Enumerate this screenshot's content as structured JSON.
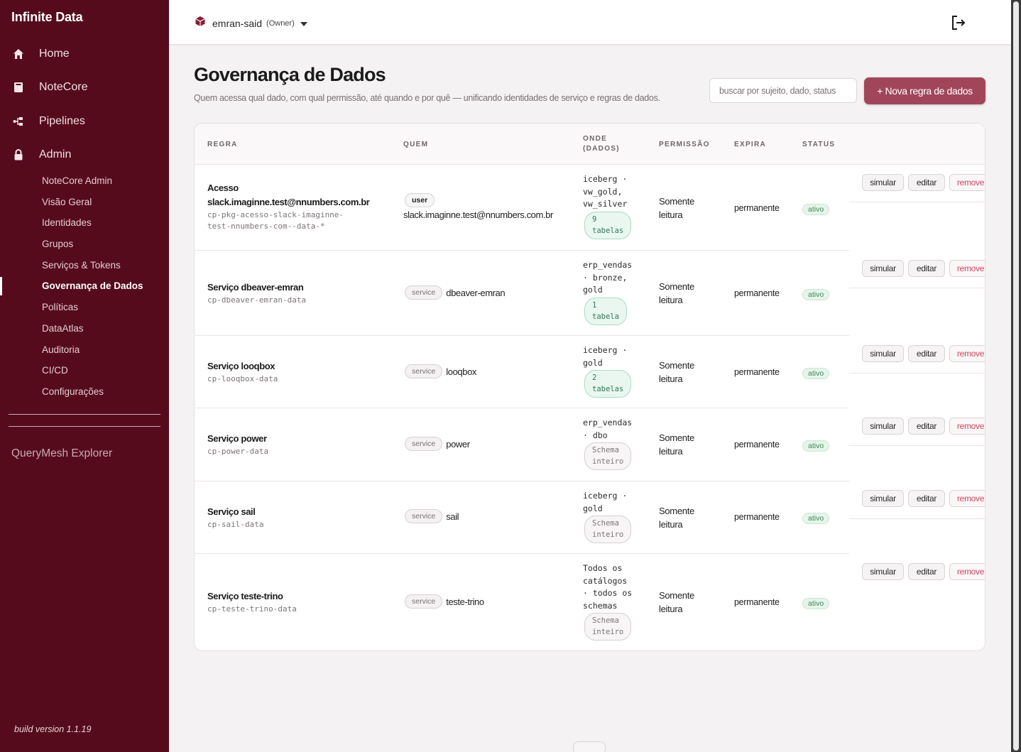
{
  "sidebar": {
    "brand": "Infinite Data",
    "main": [
      {
        "label": "Home",
        "icon": "home-icon"
      },
      {
        "label": "NoteCore",
        "icon": "notebook-icon"
      },
      {
        "label": "Pipelines",
        "icon": "pipeline-icon"
      },
      {
        "label": "Admin",
        "icon": "lock-icon"
      }
    ],
    "sub": [
      {
        "label": "NoteCore Admin"
      },
      {
        "label": "Visão Geral"
      },
      {
        "label": "Identidades"
      },
      {
        "label": "Grupos"
      },
      {
        "label": "Serviços & Tokens"
      },
      {
        "label": "Governança de Dados",
        "active": true
      },
      {
        "label": "Políticas"
      },
      {
        "label": "DataAtlas"
      },
      {
        "label": "Auditoria"
      },
      {
        "label": "CI/CD"
      },
      {
        "label": "Configurações"
      }
    ],
    "querymesh": "QueryMesh Explorer",
    "build": "build version 1.1.19",
    "bg_color": "#560b1d"
  },
  "topbar": {
    "org_name": "emran-said",
    "org_role": "(Owner)",
    "org_icon": "cube-icon",
    "logout_icon": "logout-icon"
  },
  "page": {
    "title": "Governança de Dados",
    "subtitle": "Quem acessa qual dado, com qual permissão, até quando e por quê — unificando identidades de serviço e regras de dados.",
    "search_placeholder": "buscar por sujeito, dado, status",
    "new_button": "+ Nova regra de dados",
    "accent": "#a1465a"
  },
  "table": {
    "headers": {
      "regra": "REGRA",
      "quem": "QUEM",
      "onde_1": "ONDE",
      "onde_2": "(DADOS)",
      "permissao": "PERMISSÃO",
      "expira": "EXPIRA",
      "status": "STATUS"
    },
    "action_labels": {
      "simular": "simular",
      "editar": "editar",
      "remover": "remove"
    },
    "rows": [
      {
        "name_1": "Acesso",
        "name_2": "slack.imaginne.test@nnumbers.com.br",
        "id_1": "cp-pkg-acesso-slack-imaginne-",
        "id_2": "test-nnumbers-com--data-*",
        "who_type": "user",
        "who_name": "slack.imaginne.test@nnumbers.com.br",
        "where_lines": [
          "iceberg ·",
          "vw_gold,",
          "vw_silver"
        ],
        "scope_1": "9",
        "scope_2": "tabelas",
        "scope_kind": "green",
        "perm_1": "Somente",
        "perm_2": "leitura",
        "expires": "permanente",
        "status": "ativo"
      },
      {
        "name_1": "Serviço dbeaver-emran",
        "id_1": "cp-dbeaver-emran-data",
        "who_type": "service",
        "who_name": "dbeaver-emran",
        "where_lines": [
          "erp_vendas",
          "· bronze,",
          "gold"
        ],
        "scope_1": "1",
        "scope_2": "tabela",
        "scope_kind": "green",
        "perm_1": "Somente",
        "perm_2": "leitura",
        "expires": "permanente",
        "status": "ativo"
      },
      {
        "name_1": "Serviço looqbox",
        "id_1": "cp-looqbox-data",
        "who_type": "service",
        "who_name": "looqbox",
        "where_lines": [
          "iceberg ·",
          "gold"
        ],
        "scope_1": "2",
        "scope_2": "tabelas",
        "scope_kind": "green",
        "perm_1": "Somente",
        "perm_2": "leitura",
        "expires": "permanente",
        "status": "ativo"
      },
      {
        "name_1": "Serviço power",
        "id_1": "cp-power-data",
        "who_type": "service",
        "who_name": "power",
        "where_lines": [
          "erp_vendas",
          "· dbo"
        ],
        "scope_1": "Schema",
        "scope_2": "inteiro",
        "scope_kind": "grey",
        "perm_1": "Somente",
        "perm_2": "leitura",
        "expires": "permanente",
        "status": "ativo"
      },
      {
        "name_1": "Serviço sail",
        "id_1": "cp-sail-data",
        "who_type": "service",
        "who_name": "sail",
        "where_lines": [
          "iceberg ·",
          "gold"
        ],
        "scope_1": "Schema",
        "scope_2": "inteiro",
        "scope_kind": "grey",
        "perm_1": "Somente",
        "perm_2": "leitura",
        "expires": "permanente",
        "status": "ativo"
      },
      {
        "name_1": "Serviço teste-trino",
        "id_1": "cp-teste-trino-data",
        "who_type": "service",
        "who_name": "teste-trino",
        "where_lines": [
          "Todos os",
          "catálogos",
          "· todos os",
          "schemas"
        ],
        "scope_1": "Schema",
        "scope_2": "inteiro",
        "scope_kind": "grey",
        "perm_1": "Somente",
        "perm_2": "leitura",
        "expires": "permanente",
        "status": "ativo"
      }
    ]
  }
}
